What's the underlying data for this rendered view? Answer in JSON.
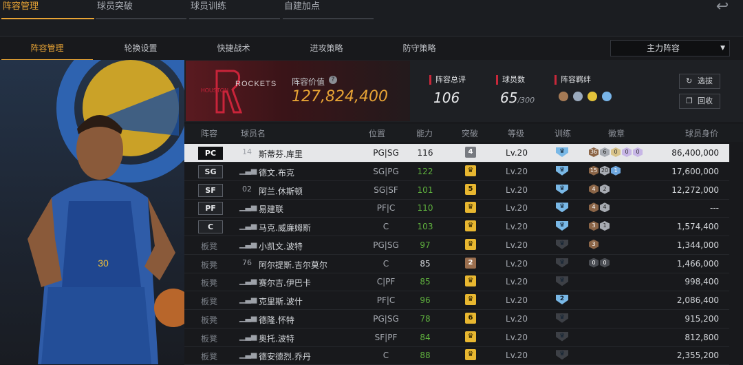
{
  "top_tabs": [
    "阵容管理",
    "球员突破",
    "球员训练",
    "自建加点"
  ],
  "sub_tabs": [
    "阵容管理",
    "轮换设置",
    "快捷战术",
    "进攻策略",
    "防守策略"
  ],
  "lineup_select": {
    "value": "主力阵容"
  },
  "team": {
    "logo_text": "ROCKETS",
    "value_label": "阵容价值",
    "value": "127,824,400",
    "rating_label": "阵容总评",
    "rating": "106",
    "player_count_label": "球员数",
    "player_count": "65",
    "player_count_max": "/300",
    "bond_label": "阵容羁绊",
    "select_button": "选拔",
    "recycle_button": "回收"
  },
  "columns": [
    "阵容",
    "球员名",
    "位置",
    "能力",
    "突破",
    "等级",
    "训练",
    "徽章",
    "球员身价"
  ],
  "players": [
    {
      "slot": "PC",
      "rank": "14",
      "name": "斯蒂芬.库里",
      "pos": "PG|SG",
      "ability": "116",
      "ability_boost": false,
      "break": "4",
      "break_style": "grey",
      "level": "Lv.20",
      "train": "",
      "train_active": true,
      "badges": [
        {
          "t": "36",
          "c": "bronze"
        },
        {
          "t": "6",
          "c": "silver"
        },
        {
          "t": "0",
          "c": "gold"
        },
        {
          "t": "0",
          "c": "purple"
        },
        {
          "t": "0",
          "c": "purple"
        }
      ],
      "value": "86,400,000",
      "selected": true
    },
    {
      "slot": "SG",
      "rank": "",
      "name": "德文.布克",
      "pos": "SG|PG",
      "ability": "122",
      "ability_boost": true,
      "break": "",
      "break_style": "gold",
      "level": "Lv.20",
      "train": "",
      "train_active": true,
      "badges": [
        {
          "t": "15",
          "c": "bronze"
        },
        {
          "t": "20",
          "c": "silver"
        },
        {
          "t": "1",
          "c": "blue"
        }
      ],
      "value": "17,600,000",
      "selected": false
    },
    {
      "slot": "SF",
      "rank": "02",
      "name": "阿兰.休斯顿",
      "pos": "SG|SF",
      "ability": "101",
      "ability_boost": true,
      "break": "5",
      "break_style": "gold",
      "level": "Lv.20",
      "train": "",
      "train_active": true,
      "badges": [
        {
          "t": "4",
          "c": "bronze"
        },
        {
          "t": "2",
          "c": "silver"
        }
      ],
      "value": "12,272,000",
      "selected": false
    },
    {
      "slot": "PF",
      "rank": "",
      "name": "易建联",
      "pos": "PF|C",
      "ability": "110",
      "ability_boost": true,
      "break": "",
      "break_style": "gold",
      "level": "Lv.20",
      "train": "",
      "train_active": true,
      "badges": [
        {
          "t": "4",
          "c": "bronze"
        },
        {
          "t": "4",
          "c": "silver"
        }
      ],
      "value": "---",
      "selected": false
    },
    {
      "slot": "C",
      "rank": "",
      "name": "马克.威廉姆斯",
      "pos": "C",
      "ability": "103",
      "ability_boost": true,
      "break": "",
      "break_style": "gold",
      "level": "Lv.20",
      "train": "",
      "train_active": true,
      "badges": [
        {
          "t": "3",
          "c": "bronze"
        },
        {
          "t": "1",
          "c": "silver"
        }
      ],
      "value": "1,574,400",
      "selected": false
    },
    {
      "slot": "板凳",
      "rank": "",
      "name": "小凯文.波特",
      "pos": "PG|SG",
      "ability": "97",
      "ability_boost": true,
      "break": "",
      "break_style": "gold",
      "level": "Lv.20",
      "train": "",
      "train_active": false,
      "badges": [
        {
          "t": "3",
          "c": "bronze"
        }
      ],
      "value": "1,344,000",
      "selected": false
    },
    {
      "slot": "板凳",
      "rank": "76",
      "name": "阿尔提斯.吉尔莫尔",
      "pos": "C",
      "ability": "85",
      "ability_boost": false,
      "break": "2",
      "break_style": "bronze",
      "level": "Lv.20",
      "train": "",
      "train_active": false,
      "badges": [
        {
          "t": "0",
          "c": "dark"
        },
        {
          "t": "0",
          "c": "dark"
        }
      ],
      "value": "1,466,000",
      "selected": false
    },
    {
      "slot": "板凳",
      "rank": "",
      "name": "赛尔吉.伊巴卡",
      "pos": "C|PF",
      "ability": "85",
      "ability_boost": true,
      "break": "",
      "break_style": "gold",
      "level": "Lv.20",
      "train": "",
      "train_active": false,
      "badges": [],
      "value": "998,400",
      "selected": false
    },
    {
      "slot": "板凳",
      "rank": "",
      "name": "克里斯.波什",
      "pos": "PF|C",
      "ability": "96",
      "ability_boost": true,
      "break": "",
      "break_style": "gold",
      "level": "Lv.20",
      "train": "2",
      "train_active": true,
      "badges": [],
      "value": "2,086,400",
      "selected": false
    },
    {
      "slot": "板凳",
      "rank": "",
      "name": "德隆.怀特",
      "pos": "PG|SG",
      "ability": "78",
      "ability_boost": true,
      "break": "6",
      "break_style": "gold",
      "level": "Lv.20",
      "train": "",
      "train_active": false,
      "badges": [],
      "value": "915,200",
      "selected": false
    },
    {
      "slot": "板凳",
      "rank": "",
      "name": "奥托.波特",
      "pos": "SF|PF",
      "ability": "84",
      "ability_boost": true,
      "break": "",
      "break_style": "gold",
      "level": "Lv.20",
      "train": "",
      "train_active": false,
      "badges": [],
      "value": "812,800",
      "selected": false
    },
    {
      "slot": "板凳",
      "rank": "",
      "name": "德安德烈.乔丹",
      "pos": "C",
      "ability": "88",
      "ability_boost": true,
      "break": "",
      "break_style": "gold",
      "level": "Lv.20",
      "train": "",
      "train_active": false,
      "badges": [],
      "value": "2,355,200",
      "selected": false
    }
  ]
}
